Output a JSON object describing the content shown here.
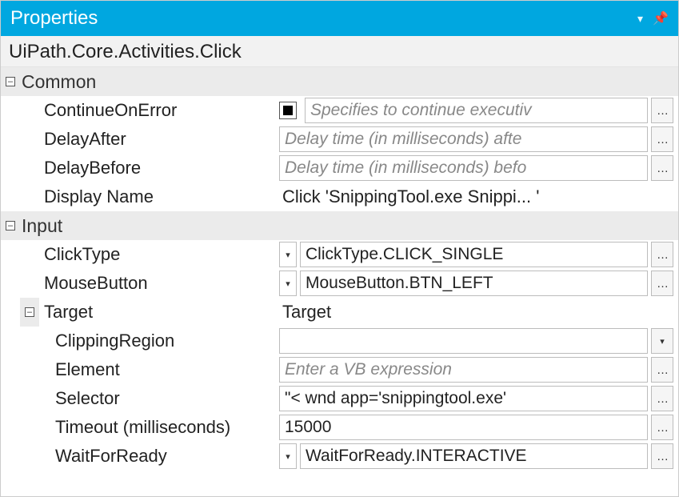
{
  "title": "Properties",
  "class_name": "UiPath.Core.Activities.Click",
  "categories": {
    "common": "Common",
    "input": "Input",
    "target": "Target"
  },
  "target_value": "Target",
  "props": {
    "continueOnError": {
      "label": "ContinueOnError",
      "placeholder": "Specifies to continue executiv"
    },
    "delayAfter": {
      "label": "DelayAfter",
      "placeholder": "Delay time (in milliseconds) afte"
    },
    "delayBefore": {
      "label": "DelayBefore",
      "placeholder": "Delay time (in milliseconds) befo"
    },
    "displayName": {
      "label": "Display Name",
      "value": "Click 'SnippingTool.exe Snippi... '"
    },
    "clickType": {
      "label": "ClickType",
      "value": "ClickType.CLICK_SINGLE"
    },
    "mouseButton": {
      "label": "MouseButton",
      "value": "MouseButton.BTN_LEFT"
    },
    "clippingRegion": {
      "label": "ClippingRegion",
      "value": ""
    },
    "element": {
      "label": "Element",
      "placeholder": "Enter a VB expression"
    },
    "selector": {
      "label": "Selector",
      "value": "\"< wnd app='snippingtool.exe' "
    },
    "timeout": {
      "label": "Timeout (milliseconds)",
      "value": "15000"
    },
    "waitForReady": {
      "label": "WaitForReady",
      "value": "WaitForReady.INTERACTIVE"
    }
  }
}
